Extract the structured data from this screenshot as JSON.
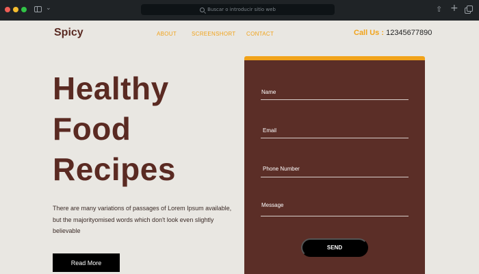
{
  "browser": {
    "address_placeholder": "Buscar o introducir sitio web"
  },
  "header": {
    "logo": "Spicy",
    "nav": [
      "ABOUT",
      "SCREENSHORT",
      "CONTACT"
    ],
    "call_label": "Call Us :",
    "call_number": "12345677890"
  },
  "hero": {
    "title_lines": [
      "Healthy",
      "Food",
      "Recipes"
    ],
    "description": "There are many variations of passages of Lorem Ipsum available, but the majorityomised words which don't look even slightly believable",
    "button_label": "Read More"
  },
  "form": {
    "fields": [
      "Name",
      "Email",
      "Phone Number",
      "Message"
    ],
    "submit_label": "SEND"
  },
  "colors": {
    "brand_brown": "#5b2e27",
    "accent_orange": "#f1a31a",
    "page_bg": "#e9e7e2"
  }
}
